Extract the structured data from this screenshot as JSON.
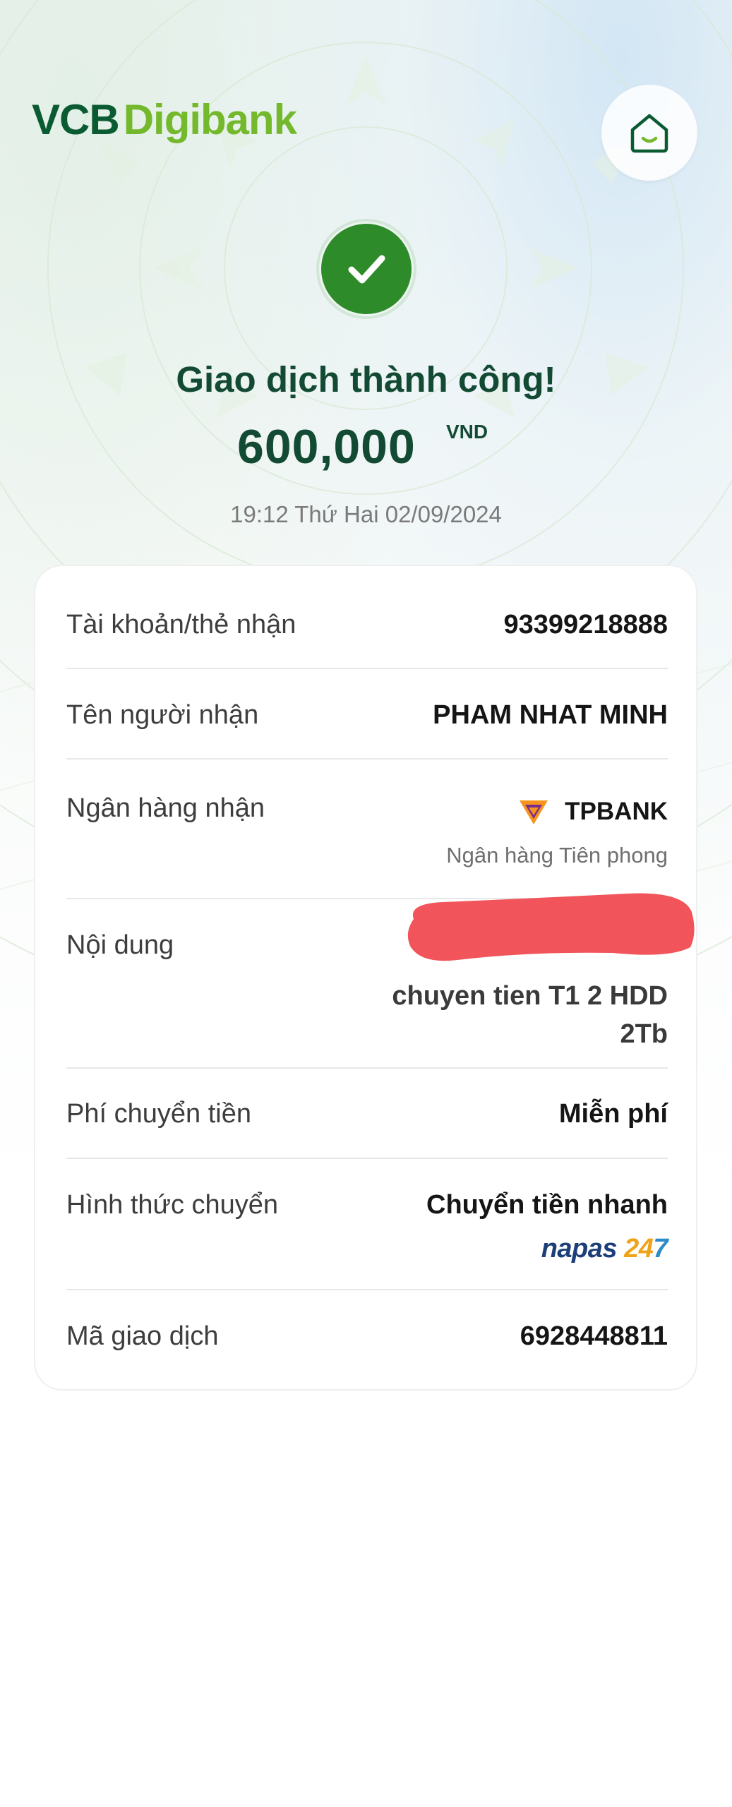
{
  "brand": {
    "part1": "VCB",
    "part2": "Digibank"
  },
  "status": {
    "title": "Giao dịch thành công!",
    "amount": "600,000",
    "currency": "VND",
    "datetime": "19:12 Thứ Hai 02/09/2024"
  },
  "details": {
    "account": {
      "label": "Tài khoản/thẻ nhận",
      "value": "93399218888"
    },
    "recipient": {
      "label": "Tên người nhận",
      "value": "PHAM NHAT MINH"
    },
    "bank": {
      "label": "Ngân hàng nhận",
      "value": "TPBANK",
      "full_name": "Ngân hàng Tiên phong"
    },
    "content": {
      "label": "Nội dung",
      "value": "chuyen tien T1 2 HDD 2Tb"
    },
    "fee": {
      "label": "Phí chuyển tiền",
      "value": "Miễn phí"
    },
    "method": {
      "label": "Hình thức chuyển",
      "value": "Chuyển tiền nhanh",
      "network_part1": "napas ",
      "network_part2": "24",
      "network_part3": "7"
    },
    "transaction_id": {
      "label": "Mã giao dịch",
      "value": "6928448811"
    }
  },
  "colors": {
    "brand_dark": "#0b5b32",
    "brand_light": "#74b82c",
    "success": "#2e8b2a",
    "title": "#124a33",
    "redaction": "#f2545b",
    "tpbank": "#f7941d"
  },
  "icons": {
    "home": "home-icon",
    "success": "checkmark-icon",
    "bank": "tpbank-logo-icon"
  }
}
